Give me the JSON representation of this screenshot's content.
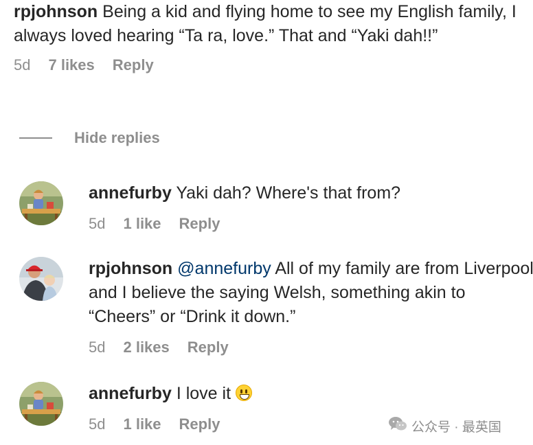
{
  "root_comment": {
    "username": "rpjohnson",
    "text": "Being a kid and flying home to see my English family, I always loved hearing “Ta ra, love.” That and “Yaki dah!!”",
    "age": "5d",
    "likes": "7 likes",
    "reply_label": "Reply"
  },
  "hide_replies_label": "Hide replies",
  "replies": [
    {
      "username": "annefurby",
      "mention": "",
      "text": "Yaki dah? Where's that from?",
      "age": "5d",
      "likes": "1 like",
      "reply_label": "Reply",
      "avatar": "child-photo-avatar"
    },
    {
      "username": "rpjohnson",
      "mention": "@annefurby",
      "text": "All of my family are from Liverpool and I believe the saying Welsh, something akin to “Cheers” or “Drink it down.”",
      "age": "5d",
      "likes": "2 likes",
      "reply_label": "Reply",
      "avatar": "man-with-child-avatar"
    },
    {
      "username": "annefurby",
      "mention": "",
      "text": "I love it",
      "emoji": "grinning-face-emoji",
      "age": "5d",
      "likes": "1 like",
      "reply_label": "Reply",
      "avatar": "child-photo-avatar"
    }
  ],
  "watermark": {
    "icon": "wechat-icon",
    "text": "公众号 · 最英国"
  },
  "colors": {
    "text": "#262626",
    "meta": "#8e8e8e",
    "mention": "#00376b",
    "background": "#ffffff"
  }
}
